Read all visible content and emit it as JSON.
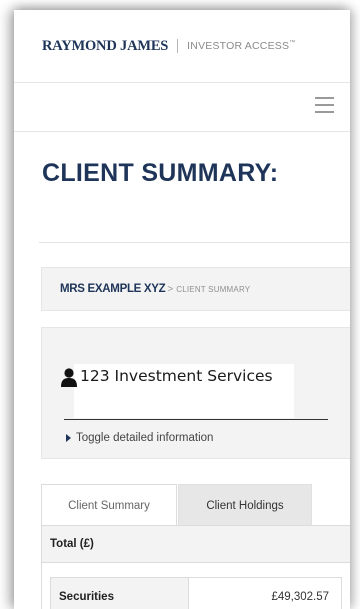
{
  "header": {
    "brand": "RAYMOND JAMES",
    "portal_name": "INVESTOR ACCESS",
    "trademark": "™"
  },
  "nav": {
    "menu_icon": "hamburger-menu-icon"
  },
  "page": {
    "title": "CLIENT SUMMARY:"
  },
  "breadcrumb": {
    "client": "MRS EXAMPLE XYZ",
    "separator": ">",
    "current": "CLIENT SUMMARY"
  },
  "client": {
    "icon": "person-icon",
    "name": "123 Investment Services",
    "toggle_icon": "caret-right-icon",
    "toggle_label": "Toggle detailed information"
  },
  "tabs": [
    {
      "label": "Client Summary",
      "active": true
    },
    {
      "label": "Client Holdings",
      "active": false
    }
  ],
  "summary": {
    "total_label": "Total (£)",
    "rows": [
      {
        "label": "Securities",
        "value": "£49,302.57"
      }
    ]
  },
  "colors": {
    "brand_navy": "#1e3458",
    "panel_bg": "#f3f3f3",
    "border": "#dcdcdc"
  }
}
